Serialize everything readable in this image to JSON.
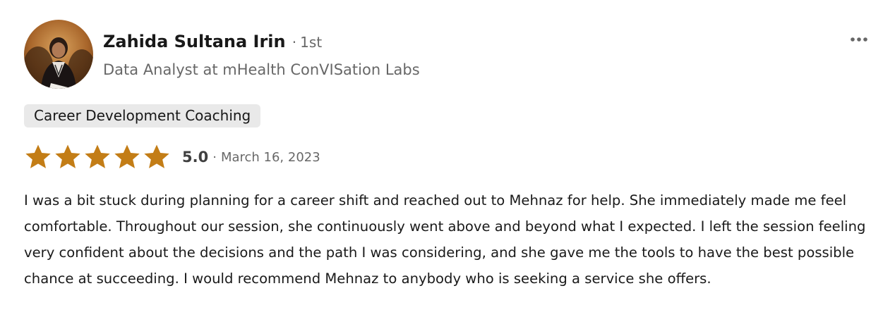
{
  "reviewer": {
    "name": "Zahida Sultana Irin",
    "separator": "·",
    "degree": "1st",
    "headline": "Data Analyst at mHealth ConVISation Labs",
    "avatar_icon": "profile-photo"
  },
  "menu": {
    "icon": "more-horizontal-icon",
    "label": "•••"
  },
  "service_tag": "Career Development Coaching",
  "rating": {
    "stars_filled": 5,
    "stars_total": 5,
    "score": "5.0",
    "separator": "·",
    "date": "March 16, 2023",
    "star_color": "#c37d16"
  },
  "review_text": "I was a bit stuck during planning for a career shift and reached out to Mehnaz for help. She immediately made me feel comfortable. Throughout our session, she continuously went above and beyond what I expected. I left the session feeling very confident about the decisions and the path I was considering, and she gave me the tools to have the best possible chance at succeeding. I would recommend Mehnaz to anybody who is seeking a service she offers."
}
